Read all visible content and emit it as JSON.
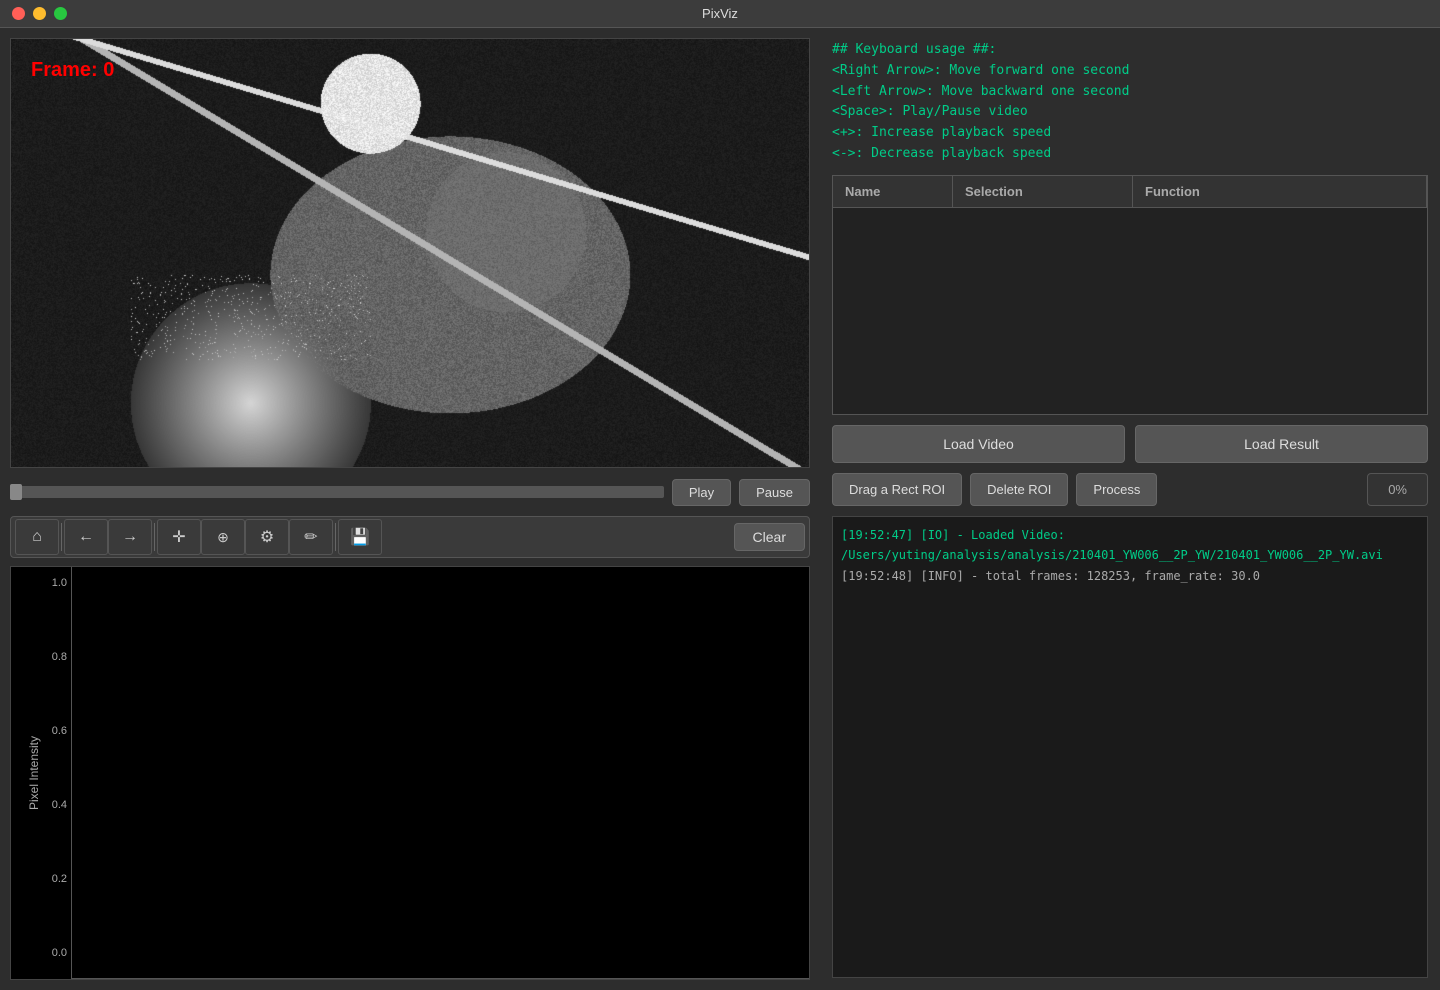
{
  "app": {
    "title": "PixViz"
  },
  "keyboard_help": {
    "heading": "## Keyboard usage ##:",
    "lines": [
      "<Right Arrow>: Move forward one second",
      "<Left Arrow>: Move backward one second",
      "<Space>: Play/Pause video",
      "<+>: Increase playback speed",
      "<->: Decrease playback speed"
    ]
  },
  "video": {
    "frame_label": "Frame: 0"
  },
  "controls": {
    "play": "Play",
    "pause": "Pause",
    "clear": "Clear"
  },
  "toolbar": {
    "home": "⌂",
    "back": "←",
    "forward": "→",
    "pan": "✛",
    "zoom": "🔍",
    "settings": "⚙",
    "edit": "✏",
    "save": "💾"
  },
  "roi_table": {
    "columns": [
      "Name",
      "Selection",
      "Function"
    ],
    "rows": []
  },
  "buttons": {
    "load_video": "Load Video",
    "load_result": "Load Result",
    "drag_rect_roi": "Drag a Rect ROI",
    "delete_roi": "Delete ROI",
    "process": "Process",
    "progress": "0%"
  },
  "chart": {
    "y_label": "Pixel Intensity",
    "y_ticks": [
      "1.0",
      "0.8",
      "0.6",
      "0.4",
      "0.2",
      "0.0"
    ]
  },
  "log": {
    "lines": [
      {
        "type": "io",
        "text": "[19:52:47] [IO] - Loaded Video: /Users/yuting/analysis/analysis/210401_YW006__2P_YW/210401_YW006__2P_YW.avi"
      },
      {
        "type": "info",
        "text": "[19:52:48] [INFO] - total frames: 128253, frame_rate: 30.0"
      }
    ]
  }
}
